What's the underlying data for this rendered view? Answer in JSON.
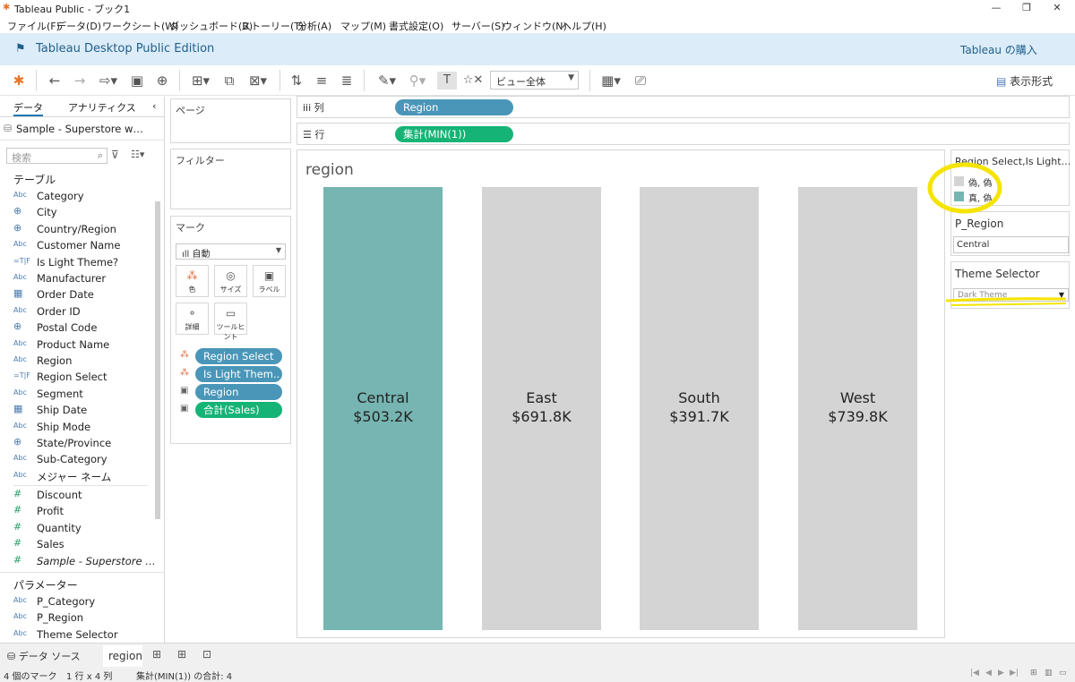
{
  "window": {
    "title": "Tableau Public - ブック1"
  },
  "menu": [
    "ファイル(F)",
    "データ(D)",
    "ワークシート(W)",
    "ダッシュボード(B)",
    "ストーリー(T)",
    "分析(A)",
    "マップ(M)",
    "書式設定(O)",
    "サーバー(S)",
    "ウィンドウ(N)",
    "ヘルプ(H)"
  ],
  "banner": {
    "edition": "Tableau Desktop Public Edition",
    "buy": "Tableau の購入"
  },
  "toolbar": {
    "view_select": "ビュー全体",
    "show_me": "表示形式"
  },
  "data_pane": {
    "tabs": [
      "データ",
      "アナリティクス"
    ],
    "datasource": "Sample - Superstore w…",
    "search_placeholder": "検索",
    "tables_heading": "テーブル",
    "fields": [
      {
        "icon": "Abc",
        "label": "Category"
      },
      {
        "icon": "globe",
        "label": "City"
      },
      {
        "icon": "globe",
        "label": "Country/Region"
      },
      {
        "icon": "Abc",
        "label": "Customer Name"
      },
      {
        "icon": "=T|F",
        "label": "Is Light Theme?"
      },
      {
        "icon": "Abc",
        "label": "Manufacturer"
      },
      {
        "icon": "date",
        "label": "Order Date"
      },
      {
        "icon": "Abc",
        "label": "Order ID"
      },
      {
        "icon": "globe",
        "label": "Postal Code"
      },
      {
        "icon": "Abc",
        "label": "Product Name"
      },
      {
        "icon": "Abc",
        "label": "Region"
      },
      {
        "icon": "=T|F",
        "label": "Region Select"
      },
      {
        "icon": "Abc",
        "label": "Segment"
      },
      {
        "icon": "date",
        "label": "Ship Date"
      },
      {
        "icon": "Abc",
        "label": "Ship Mode"
      },
      {
        "icon": "globe",
        "label": "State/Province"
      },
      {
        "icon": "Abc",
        "label": "Sub-Category"
      },
      {
        "icon": "Abc",
        "label": "メジャー ネーム"
      }
    ],
    "measures": [
      {
        "icon": "#",
        "label": "Discount"
      },
      {
        "icon": "#",
        "label": "Profit"
      },
      {
        "icon": "#",
        "label": "Quantity"
      },
      {
        "icon": "#",
        "label": "Sales"
      },
      {
        "icon": "#",
        "label": "Sample - Superstore …"
      }
    ],
    "params_heading": "パラメーター",
    "params": [
      {
        "icon": "Abc",
        "label": "P_Category"
      },
      {
        "icon": "Abc",
        "label": "P_Region"
      },
      {
        "icon": "Abc",
        "label": "Theme Selector"
      }
    ]
  },
  "pages_card": {
    "title": "ページ"
  },
  "filters_card": {
    "title": "フィルター"
  },
  "marks_card": {
    "title": "マーク",
    "type": "自動",
    "buttons": [
      "色",
      "サイズ",
      "ラベル",
      "詳細",
      "ツールヒント"
    ],
    "pills": [
      "Region Select",
      "Is Light Them..",
      "Region",
      "合計(Sales)"
    ]
  },
  "shelves": {
    "columns_label": "列",
    "rows_label": "行",
    "columns_pill": "Region",
    "rows_pill": "集計(MIN(1))"
  },
  "viz": {
    "title": "region",
    "bars": [
      {
        "region": "Central",
        "value": "$503.2K",
        "color": "#76b5b1"
      },
      {
        "region": "East",
        "value": "$691.8K",
        "color": "#d4d4d4"
      },
      {
        "region": "South",
        "value": "$391.7K",
        "color": "#d4d4d4"
      },
      {
        "region": "West",
        "value": "$739.8K",
        "color": "#d4d4d4"
      }
    ]
  },
  "legend": {
    "title": "Region Select,Is Light…",
    "items": [
      {
        "label": "偽, 偽",
        "color": "#d4d4d4"
      },
      {
        "label": "真, 偽",
        "color": "#76b5b1"
      }
    ]
  },
  "param_region": {
    "title": "P_Region",
    "value": "Central"
  },
  "param_theme": {
    "title": "Theme Selector",
    "value": "Dark Theme"
  },
  "bottom": {
    "datasource_tab": "データ ソース",
    "sheet_tab": "region"
  },
  "status": {
    "marks": "4 個のマーク",
    "dims": "1 行 x 4 列",
    "sum": "集計(MIN(1)) の合計: 4"
  },
  "colors": {
    "highlight": "#f5e400",
    "dim_pill": "#4a96b8",
    "meas_pill": "#15b476"
  }
}
